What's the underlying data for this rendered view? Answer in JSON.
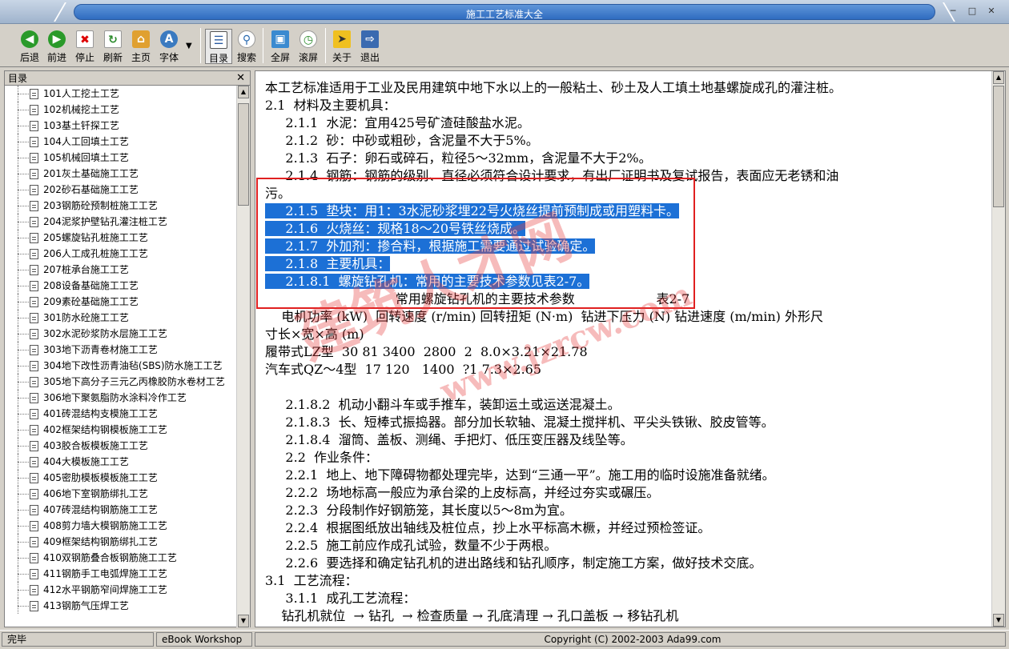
{
  "window": {
    "title": "施工工艺标准大全"
  },
  "toolbar": {
    "back": "后退",
    "forward": "前进",
    "stop": "停止",
    "refresh": "刷新",
    "home": "主页",
    "font": "字体",
    "toc": "目录",
    "search": "搜索",
    "fullscreen": "全屏",
    "scroll": "滚屏",
    "about": "关于",
    "exit": "退出"
  },
  "sidebar": {
    "title": "目录",
    "items": [
      "101人工挖土工艺",
      "102机械挖土工艺",
      "103基土钎探工艺",
      "104人工回填土工艺",
      "105机械回填土工艺",
      "201灰土基础施工工艺",
      "202砂石基础施工工艺",
      "203钢筋砼预制桩施工工艺",
      "204泥浆护壁钻孔灌注桩工艺",
      "205螺旋钻孔桩施工工艺",
      "206人工成孔桩施工工艺",
      "207桩承台施工工艺",
      "208设备基础施工工艺",
      "209素砼基础施工工艺",
      "301防水砼施工工艺",
      "302水泥砂浆防水层施工工艺",
      "303地下沥青卷材施工工艺",
      "304地下改性沥青油毡(SBS)防水施工工艺",
      "305地下高分子三元乙丙橡胶防水卷材工艺",
      "306地下聚氨脂防水涂料冷作工艺",
      "401砖混结构支模施工工艺",
      "402框架结构钢模板施工工艺",
      "403胶合板模板施工工艺",
      "404大模板施工工艺",
      "405密肋模板模板施工工艺",
      "406地下室钢筋绑扎工艺",
      "407砖混结构钢筋施工工艺",
      "408剪力墙大模钢筋施工工艺",
      "409框架结构钢筋绑扎工艺",
      "410双钢筋叠合板钢筋施工工艺",
      "411钢筋手工电弧焊施工工艺",
      "412水平钢筋窄间焊施工工艺",
      "413钢筋气压焊工艺"
    ]
  },
  "content": {
    "lines": [
      "本工艺标准适用于工业及民用建筑中地下水以上的一般粘土、砂土及人工填土地基螺旋成孔的灌注桩。",
      "2.1  材料及主要机具：",
      "     2.1.1  水泥：宜用425号矿渣硅酸盐水泥。",
      "     2.1.2  砂：中砂或粗砂，含泥量不大于5%。",
      "     2.1.3  石子：卵石或碎石，粒径5～32mm，含泥量不大于2%。",
      "     2.1.4  钢筋：钢筋的级别、直径必须符合设计要求，有出厂证明书及复试报告，表面应无老锈和油",
      "污。",
      "     2.1.5  垫块：用1：3水泥砂浆埋22号火烧丝提前预制成或用塑料卡。",
      "     2.1.6  火烧丝：规格18～20号铁丝烧成。",
      "     2.1.7  外加剂：掺合料，根据施工需要通过试验确定。",
      "     2.1.8  主要机具：",
      "     2.1.8.1  螺旋钻孔机：常用的主要技术参数见表2-7。",
      "                                常用螺旋钻孔机的主要技术参数                    表2-7",
      "    电机功率 (kW)  回转速度 (r/min) 回转扭矩 (N·m)  钻进下压力 (N) 钻进速度 (m/min) 外形尺",
      "寸长×宽×高 (m)",
      "履带式LZ型  30 81 3400  2800  2  8.0×3.21×21.78",
      "汽车式QZ～4型  17 120   1400  ?1 7.3×2.65",
      "",
      "     2.1.8.2  机动小翻斗车或手推车，装卸运土或运送混凝土。",
      "     2.1.8.3  长、短棒式振捣器。部分加长软轴、混凝土搅拌机、平尖头铁锹、胶皮管等。",
      "     2.1.8.4  溜筒、盖板、测绳、手把灯、低压变压器及线坠等。",
      "     2.2  作业条件：",
      "     2.2.1  地上、地下障碍物都处理完毕，达到“三通一平”。施工用的临时设施准备就绪。",
      "     2.2.2  场地标高一般应为承台梁的上皮标高，并经过夯实或碾压。",
      "     2.2.3  分段制作好钢筋笼，其长度以5～8m为宜。",
      "     2.2.4  根据图纸放出轴线及桩位点，抄上水平标高木橛，并经过预检签证。",
      "     2.2.5  施工前应作成孔试验，数量不少于两根。",
      "     2.2.6  要选择和确定钻孔机的进出路线和钻孔顺序，制定施工方案，做好技术交底。",
      "3.1  工艺流程：",
      "     3.1.1  成孔工艺流程：",
      "    钻孔机就位  → 钻孔  → 检查质量 → 孔底清理 → 孔口盖板 → 移钻孔机"
    ]
  },
  "watermark": {
    "cn": "建筑人才网",
    "url": "www.jzrcw.com"
  },
  "status": {
    "left": "完毕",
    "middle": "eBook Workshop",
    "right": "Copyright (C) 2002-2003 Ada99.com"
  }
}
